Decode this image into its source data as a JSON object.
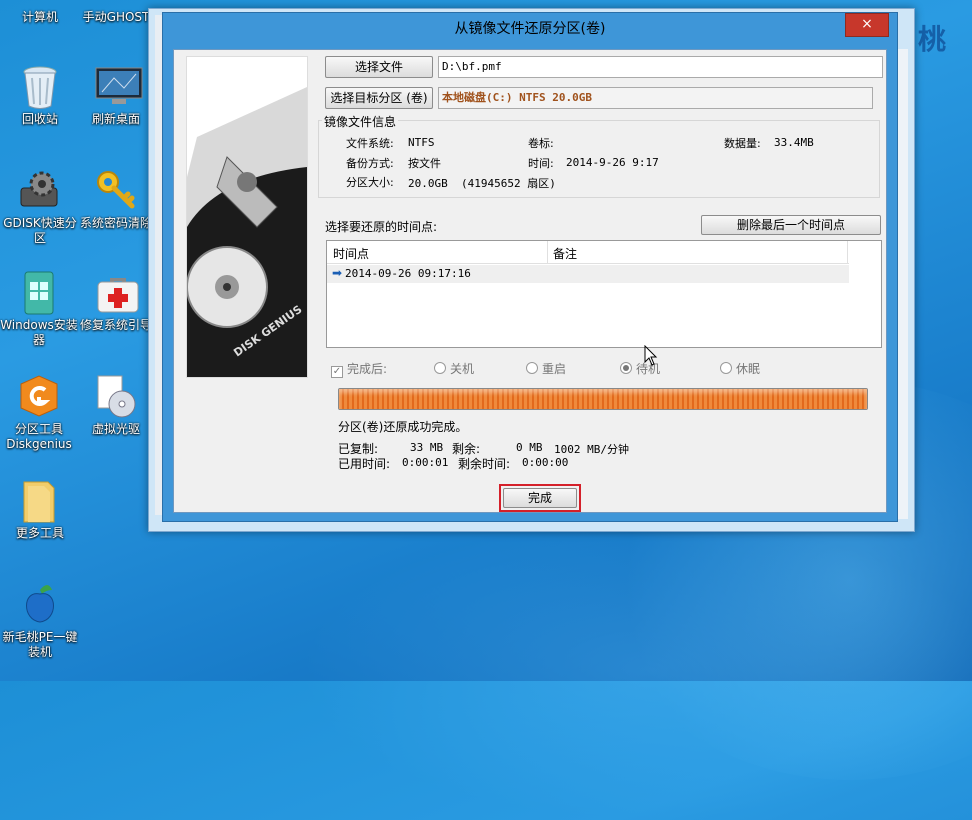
{
  "desktop": {
    "icons": [
      {
        "label": "计算机"
      },
      {
        "label": "手动GHOST"
      },
      {
        "label": "回收站"
      },
      {
        "label": "刷新桌面"
      },
      {
        "label": "GDISK快速分区"
      },
      {
        "label": "系统密码清除"
      },
      {
        "label": "Windows安装器"
      },
      {
        "label": "修复系统引导"
      },
      {
        "label": "分区工具Diskgenius"
      },
      {
        "label": "虚拟光驱"
      },
      {
        "label": "更多工具"
      },
      {
        "label": "新毛桃PE一键装机"
      }
    ],
    "right_edge_text": "桃"
  },
  "dialog": {
    "title": "从镜像文件还原分区(卷)",
    "close_glyph": "×",
    "select_file_button": "选择文件",
    "file_path": "D:\\bf.pmf",
    "select_target_button": "选择目标分区 (卷)",
    "target_value": "本地磁盘(C:) NTFS 20.0GB",
    "image_info": {
      "group_title": "镜像文件信息",
      "fs_label": "文件系统:",
      "fs_value": "NTFS",
      "volume_label": "卷标:",
      "volume_value": "",
      "data_label": "数据量:",
      "data_value": "33.4MB",
      "backup_label": "备份方式:",
      "backup_value": "按文件",
      "time_label": "时间:",
      "time_value": "2014-9-26 9:17",
      "size_label": "分区大小:",
      "size_value": "20.0GB  (41945652 扇区)"
    },
    "timepoint_prompt": "选择要还原的时间点:",
    "delete_last_button": "删除最后一个时间点",
    "table": {
      "headers": [
        "时间点",
        "备注"
      ],
      "rows": [
        {
          "time": "2014-09-26 09:17:16",
          "note": ""
        }
      ]
    },
    "after_label": "完成后:",
    "options": [
      {
        "label": "关机",
        "selected": false
      },
      {
        "label": "重启",
        "selected": false
      },
      {
        "label": "待机",
        "selected": true
      },
      {
        "label": "休眠",
        "selected": false
      }
    ],
    "progress_percent": 100,
    "status_text": "分区(卷)还原成功完成。",
    "copied_label": "已复制:",
    "copied_value": "33 MB",
    "remaining_label": "剩余:",
    "remaining_value": "0 MB",
    "rate_value": "1002 MB/分钟",
    "elapsed_label": "已用时间:",
    "elapsed_value": "0:00:01",
    "remaining_time_label": "剩余时间:",
    "remaining_time_value": "0:00:00",
    "done_button": "完成",
    "disk_image_text": "DISK GENIUS"
  },
  "colors": {
    "accent_red": "#d4202a",
    "progress_orange": "#ec7a2a",
    "target_text": "#a0521c"
  }
}
